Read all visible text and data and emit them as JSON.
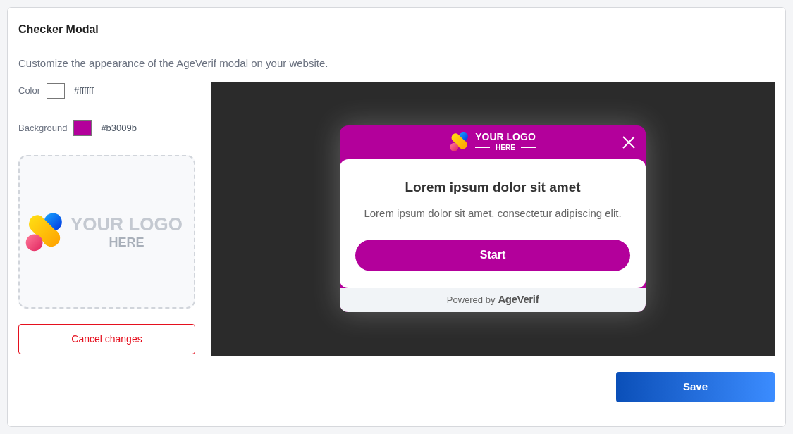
{
  "title": "Checker Modal",
  "description": "Customize the appearance of the AgeVerif modal on your website.",
  "color_fields": [
    {
      "label": "Color",
      "value": "#ffffff",
      "color": "#ffffff"
    },
    {
      "label": "Background",
      "value": "#b3009b",
      "color": "#b3009b"
    }
  ],
  "logo_upload": {
    "logo_title": "YOUR LOGO",
    "logo_subtitle": "HERE"
  },
  "cancel_button": "Cancel changes",
  "preview": {
    "logo_title": "YOUR LOGO",
    "logo_subtitle": "HERE",
    "heading": "Lorem ipsum dolor sit amet",
    "text": "Lorem ipsum dolor sit amet, consectetur adipiscing elit.",
    "button": "Start",
    "powered_by": "Powered by",
    "brand": "AgeVerif"
  },
  "save_button": "Save"
}
